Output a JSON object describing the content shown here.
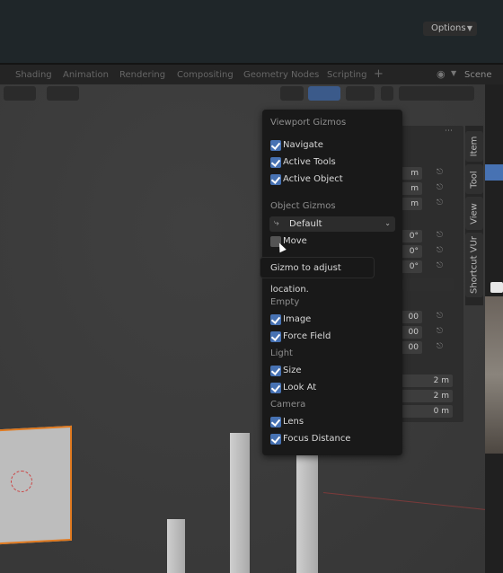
{
  "workspace_tabs": [
    {
      "label": "Shading"
    },
    {
      "label": "Animation"
    },
    {
      "label": "Rendering"
    },
    {
      "label": "Compositing"
    },
    {
      "label": "Geometry Nodes"
    },
    {
      "label": "Scripting"
    }
  ],
  "add_tab": "+",
  "scene_label": "Scene",
  "viewport": {
    "options_label": "Options"
  },
  "sidebar_tabs": [
    "Item",
    "Tool",
    "View",
    "Shortcut VUr"
  ],
  "npanel_values": {
    "loc_unit": [
      "m",
      "m",
      "m"
    ],
    "rot_unit": [
      "0°",
      "0°",
      "0°"
    ],
    "scale": [
      "00",
      "00",
      "00"
    ],
    "dims": [
      "2 m",
      "2 m",
      "0 m"
    ]
  },
  "gizmo_popover": {
    "viewport_gizmos_title": "Viewport Gizmos",
    "viewport_items": [
      {
        "label": "Navigate",
        "checked": true
      },
      {
        "label": "Active Tools",
        "checked": true
      },
      {
        "label": "Active Object",
        "checked": true
      }
    ],
    "object_gizmos_title": "Object Gizmos",
    "orientation_dropdown": "Default",
    "move_item": {
      "label": "Move",
      "checked": false
    },
    "empty_title": "Empty",
    "empty_items": [
      {
        "label": "Image",
        "checked": true
      },
      {
        "label": "Force Field",
        "checked": true
      }
    ],
    "light_title": "Light",
    "light_items": [
      {
        "label": "Size",
        "checked": true
      },
      {
        "label": "Look At",
        "checked": true
      }
    ],
    "camera_title": "Camera",
    "camera_items": [
      {
        "label": "Lens",
        "checked": true
      },
      {
        "label": "Focus Distance",
        "checked": true
      }
    ]
  },
  "tooltip": "Gizmo to adjust location.",
  "colors": {
    "checkbox_blue": "#4772b3",
    "selection_orange": "#e07a20"
  }
}
